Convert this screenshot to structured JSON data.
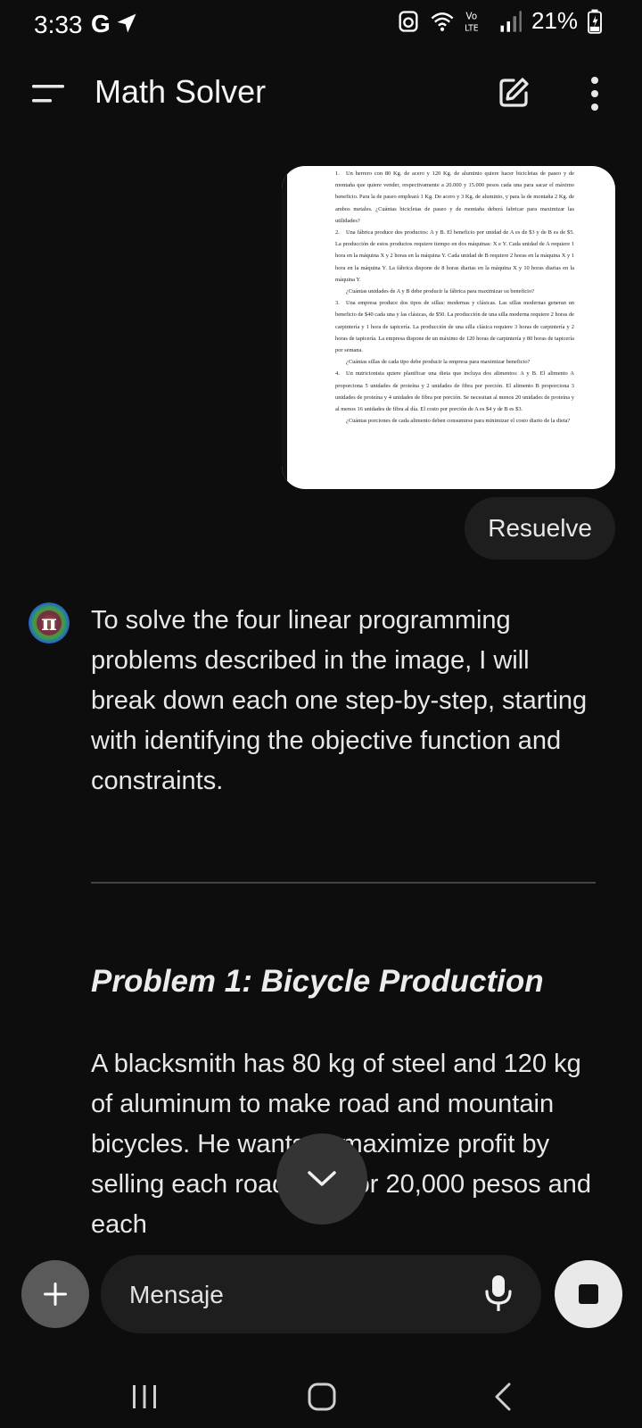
{
  "status_bar": {
    "time": "3:33",
    "g_label": "G",
    "battery": "21%",
    "icons": [
      "send-icon",
      "alarm-icon",
      "wifi-icon",
      "volte-icon",
      "signal-icon",
      "battery-icon"
    ]
  },
  "header": {
    "title": "Math Solver",
    "icons": [
      "menu-icon",
      "edit-icon",
      "more-icon"
    ]
  },
  "attachment": {
    "paragraphs": [
      {
        "num": "1.",
        "text": "Un herrero con 80 Kg. de acero y 120 Kg. de aluminio quiere hacer bicicletas de paseo y de montaña que quiere vender, respectivamente a 20.000 y 15.000 pesos cada una para sacar el máximo beneficio. Para la de paseo empleará 1 Kg. De acero y 3 Kg. de aluminio, y para la de montaña 2 Kg. de ambos metales. ¿Cuántas bicicletas de paseo y de montaña deberá fabricar para maximizar las utilidades?"
      },
      {
        "num": "2.",
        "text": "Una fábrica produce dos productos: A y B. El beneficio por unidad de A es de $3 y de B es de $5. La producción de estos productos requiere tiempo en dos máquinas: X e Y. Cada unidad de A requiere 1 hora en la máquina X y 2 horas en la máquina Y. Cada unidad de B requiere 2 horas en la máquina X y 1 hora en la máquina Y. La fábrica dispone de 8 horas diarias en la máquina X y 10 horas diarias en la máquina Y."
      },
      {
        "num": "",
        "text": "¿Cuántas unidades de A y B debe producir la fábrica para maximizar su beneficio?"
      },
      {
        "num": "3.",
        "text": "Una empresa produce dos tipos de sillas: modernas y clásicas. Las sillas modernas generan un beneficio de $40 cada una y las clásicas, de $50. La producción de una silla moderna requiere 2 horas de carpintería y 1 hora de tapicería. La producción de una silla clásica requiere 3 horas de carpintería y 2 horas de tapicería. La empresa dispone de un máximo de 120 horas de carpintería y 80 horas de tapicería por semana."
      },
      {
        "num": "",
        "text": "¿Cuántas sillas de cada tipo debe producir la empresa para maximizar beneficio?"
      },
      {
        "num": "4.",
        "text": "Un nutricionista quiere planificar una dieta que incluya dos alimentos: A y B. El alimento A proporciona 5 unidades de proteína y 2 unidades de fibra por porción. El alimento B proporciona 3 unidades de proteína y 4 unidades de fibra por porción. Se necesitan al menos 20 unidades de proteína y al menos 16 unidades de fibra al día. El costo por porción de A es $4 y de B es $3."
      },
      {
        "num": "",
        "text": "¿Cuántas porciones de cada alimento deben consumirse para minimizar el costo diario de la dieta?"
      }
    ]
  },
  "user_message": "Resuelve",
  "assistant": {
    "intro": "To solve the four linear programming problems described in the image, I will break down each one step-by-step, starting with identifying the objective function and constraints.",
    "problem_heading": "Problem 1: Bicycle Production",
    "problem_text": "A blacksmith has 80 kg of steel and 120 kg of aluminum to make road and mountain bicycles. He wants to maximize profit by selling each road bike for 20,000 pesos and each"
  },
  "composer": {
    "placeholder": "Mensaje"
  },
  "colors": {
    "background": "#0d0d0d",
    "bubble": "#1e1e1e",
    "text": "#e8e8e8"
  }
}
